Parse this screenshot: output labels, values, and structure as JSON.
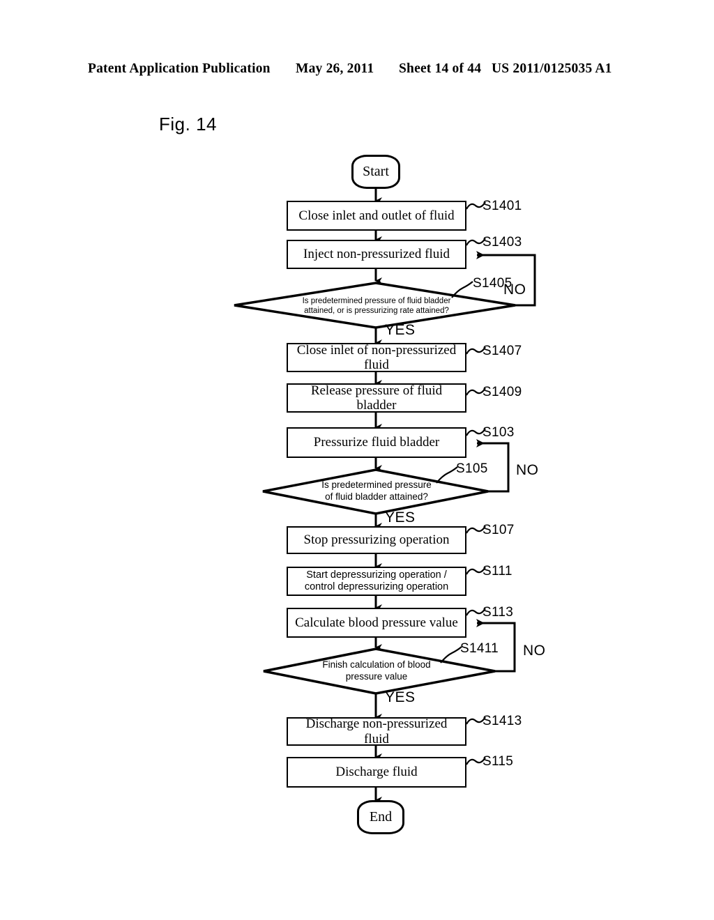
{
  "header": {
    "publication": "Patent Application Publication",
    "date": "May 26, 2011",
    "sheet": "Sheet 14 of 44",
    "patent_number": "US 2011/0125035 A1"
  },
  "figure": {
    "label": "Fig. 14"
  },
  "flowchart": {
    "type": "flowchart",
    "nodes": [
      {
        "id": "start",
        "kind": "terminal",
        "text": "Start"
      },
      {
        "id": "s1401",
        "kind": "process",
        "text": "Close inlet and outlet of fluid",
        "tag": "S1401"
      },
      {
        "id": "s1403",
        "kind": "process",
        "text": "Inject non-pressurized fluid",
        "tag": "S1403"
      },
      {
        "id": "s1405",
        "kind": "decision",
        "text": "Is predetermined pressure of fluid bladder attained, or is pressurizing rate attained?",
        "tag": "S1405",
        "yes": "YES",
        "no": "NO"
      },
      {
        "id": "s1407",
        "kind": "process",
        "text": "Close inlet of non-pressurized fluid",
        "tag": "S1407"
      },
      {
        "id": "s1409",
        "kind": "process",
        "text": "Release pressure of fluid bladder",
        "tag": "S1409"
      },
      {
        "id": "s103",
        "kind": "process",
        "text": "Pressurize fluid bladder",
        "tag": "S103"
      },
      {
        "id": "s105",
        "kind": "decision",
        "text": "Is predetermined pressure of fluid bladder attained?",
        "tag": "S105",
        "yes": "YES",
        "no": "NO"
      },
      {
        "id": "s107",
        "kind": "process",
        "text": "Stop pressurizing operation",
        "tag": "S107"
      },
      {
        "id": "s111",
        "kind": "process",
        "text": "Start depressurizing operation / control depressurizing operation",
        "tag": "S111"
      },
      {
        "id": "s113",
        "kind": "process",
        "text": "Calculate blood pressure value",
        "tag": "S113"
      },
      {
        "id": "s1411",
        "kind": "decision",
        "text": "Finish calculation of blood pressure value",
        "tag": "S1411",
        "yes": "YES",
        "no": "NO"
      },
      {
        "id": "s1413",
        "kind": "process",
        "text": "Discharge non-pressurized fluid",
        "tag": "S1413"
      },
      {
        "id": "s115",
        "kind": "process",
        "text": "Discharge fluid",
        "tag": "S115"
      },
      {
        "id": "end",
        "kind": "terminal",
        "text": "End"
      }
    ],
    "node_text": {
      "start": "Start",
      "s1401": "Close inlet and outlet of fluid",
      "s1403": "Inject non-pressurized fluid",
      "s1405_line1": "Is predetermined pressure of fluid bladder",
      "s1405_line2": "attained, or is pressurizing rate attained?",
      "s1407_line1": "Close inlet of non-pressurized",
      "s1407_line2": "fluid",
      "s1409": "Release pressure of fluid bladder",
      "s103": "Pressurize fluid bladder",
      "s105_line1": "Is predetermined pressure",
      "s105_line2": "of fluid bladder attained?",
      "s107": "Stop pressurizing operation",
      "s111_line1": "Start depressurizing operation /",
      "s111_line2": "control depressurizing operation",
      "s113": "Calculate blood pressure value",
      "s1411_line1": "Finish calculation of blood",
      "s1411_line2": "pressure value",
      "s1413": "Discharge non-pressurized fluid",
      "s115": "Discharge fluid",
      "end": "End"
    },
    "tags": {
      "s1401": "S1401",
      "s1403": "S1403",
      "s1405": "S1405",
      "s1407": "S1407",
      "s1409": "S1409",
      "s103": "S103",
      "s105": "S105",
      "s107": "S107",
      "s111": "S111",
      "s113": "S113",
      "s1411": "S1411",
      "s1413": "S1413",
      "s115": "S115"
    },
    "branches": {
      "s1405_no": "NO",
      "s1405_yes": "YES",
      "s105_no": "NO",
      "s105_yes": "YES",
      "s1411_no": "NO",
      "s1411_yes": "YES"
    },
    "edges": [
      {
        "from": "start",
        "to": "s1401"
      },
      {
        "from": "s1401",
        "to": "s1403"
      },
      {
        "from": "s1403",
        "to": "s1405"
      },
      {
        "from": "s1405",
        "to": "s1407",
        "label": "YES"
      },
      {
        "from": "s1405",
        "to": "s1403",
        "label": "NO"
      },
      {
        "from": "s1407",
        "to": "s1409"
      },
      {
        "from": "s1409",
        "to": "s103"
      },
      {
        "from": "s103",
        "to": "s105"
      },
      {
        "from": "s105",
        "to": "s107",
        "label": "YES"
      },
      {
        "from": "s105",
        "to": "s103",
        "label": "NO"
      },
      {
        "from": "s107",
        "to": "s111"
      },
      {
        "from": "s111",
        "to": "s113"
      },
      {
        "from": "s113",
        "to": "s1411"
      },
      {
        "from": "s1411",
        "to": "s1413",
        "label": "YES"
      },
      {
        "from": "s1411",
        "to": "s113",
        "label": "NO"
      },
      {
        "from": "s1413",
        "to": "s115"
      },
      {
        "from": "s115",
        "to": "end"
      }
    ]
  },
  "colors": {
    "ink": "#000000",
    "paper": "#ffffff"
  }
}
